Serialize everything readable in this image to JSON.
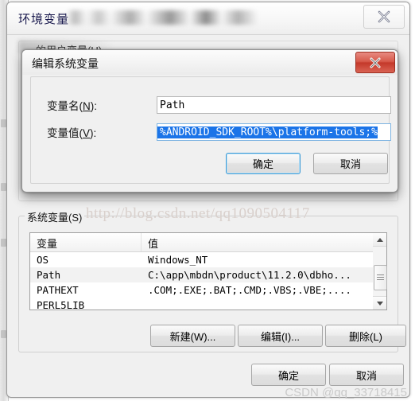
{
  "main_window": {
    "title": "环境变量",
    "title_blurred_text": "",
    "close_icon": "close-x-icon",
    "user_group_label": "的用户变量(U)",
    "system_group_label": "系统变量(S)",
    "table": {
      "columns": [
        "变量",
        "值"
      ],
      "rows": [
        {
          "name": "OS",
          "value": "Windows_NT",
          "selected": false
        },
        {
          "name": "Path",
          "value": "C:\\app\\mbdn\\product\\11.2.0\\dbho...",
          "selected": true
        },
        {
          "name": "PATHEXT",
          "value": ".COM;.EXE;.BAT;.CMD;.VBS;.VBE;....",
          "selected": false
        },
        {
          "name": "PERL5LIB",
          "value": "",
          "selected": false
        }
      ]
    },
    "buttons": {
      "new": "新建(W)...",
      "edit": "编辑(I)...",
      "delete": "删除(L)",
      "ok": "确定",
      "cancel": "取消"
    },
    "scrollbar": {
      "up_icon": "arrow-up-icon",
      "down_icon": "arrow-down-icon",
      "thumb_icon": "scroll-thumb-grip"
    }
  },
  "edit_dialog": {
    "title": "编辑系统变量",
    "close_icon": "close-x-icon",
    "fields": [
      {
        "label_prefix": "变量名(",
        "label_accel": "N",
        "label_suffix": "):",
        "value": "Path",
        "selected": false
      },
      {
        "label_prefix": "变量值(",
        "label_accel": "V",
        "label_suffix": "):",
        "value": "%ANDROID_SDK_ROOT%\\platform-tools;%",
        "selected": true
      }
    ],
    "buttons": {
      "ok": "确定",
      "cancel": "取消"
    }
  },
  "watermarks": {
    "url": "http://blog.csdn.net/qq1090504117",
    "csdn": "CSDN @qq_33718415"
  },
  "colors": {
    "selection_blue": "#1b74e8",
    "dialog_close_red": "#c4392a",
    "focus_border_blue": "#3c9ad6",
    "window_bg": "#f0f0f0",
    "watermark_url": "#d9d0cc",
    "watermark_csdn": "#c9c9c9"
  }
}
